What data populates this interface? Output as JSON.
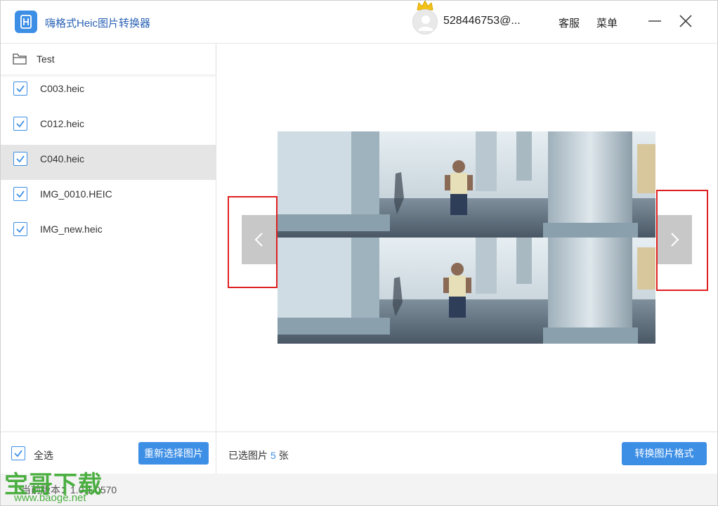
{
  "app": {
    "title": "嗨格式Heic图片转换器",
    "logo_icon": "app-logo-icon",
    "brand_color": "#3d8fe6"
  },
  "header": {
    "user_id": "528446753@...",
    "service_label": "客服",
    "menu_label": "菜单",
    "minimize_icon": "minimize-icon",
    "close_icon": "close-icon"
  },
  "sidebar": {
    "folder_name": "Test",
    "files": [
      {
        "name": "C003.heic",
        "checked": true,
        "active": false
      },
      {
        "name": "C012.heic",
        "checked": true,
        "active": false
      },
      {
        "name": "C040.heic",
        "checked": true,
        "active": true
      },
      {
        "name": "IMG_0010.HEIC",
        "checked": true,
        "active": false
      },
      {
        "name": "IMG_new.heic",
        "checked": true,
        "active": false
      }
    ],
    "select_all_label": "全选",
    "reselect_label": "重新选择图片"
  },
  "main": {
    "selected_prefix": "已选图片",
    "selected_count": "5",
    "selected_suffix": "张",
    "convert_label": "转换图片格式"
  },
  "statusbar": {
    "version_text": "当前版本：1.0.1.0570",
    "watermark_big": "宝哥下载",
    "watermark_url": "www.baoge.net"
  }
}
